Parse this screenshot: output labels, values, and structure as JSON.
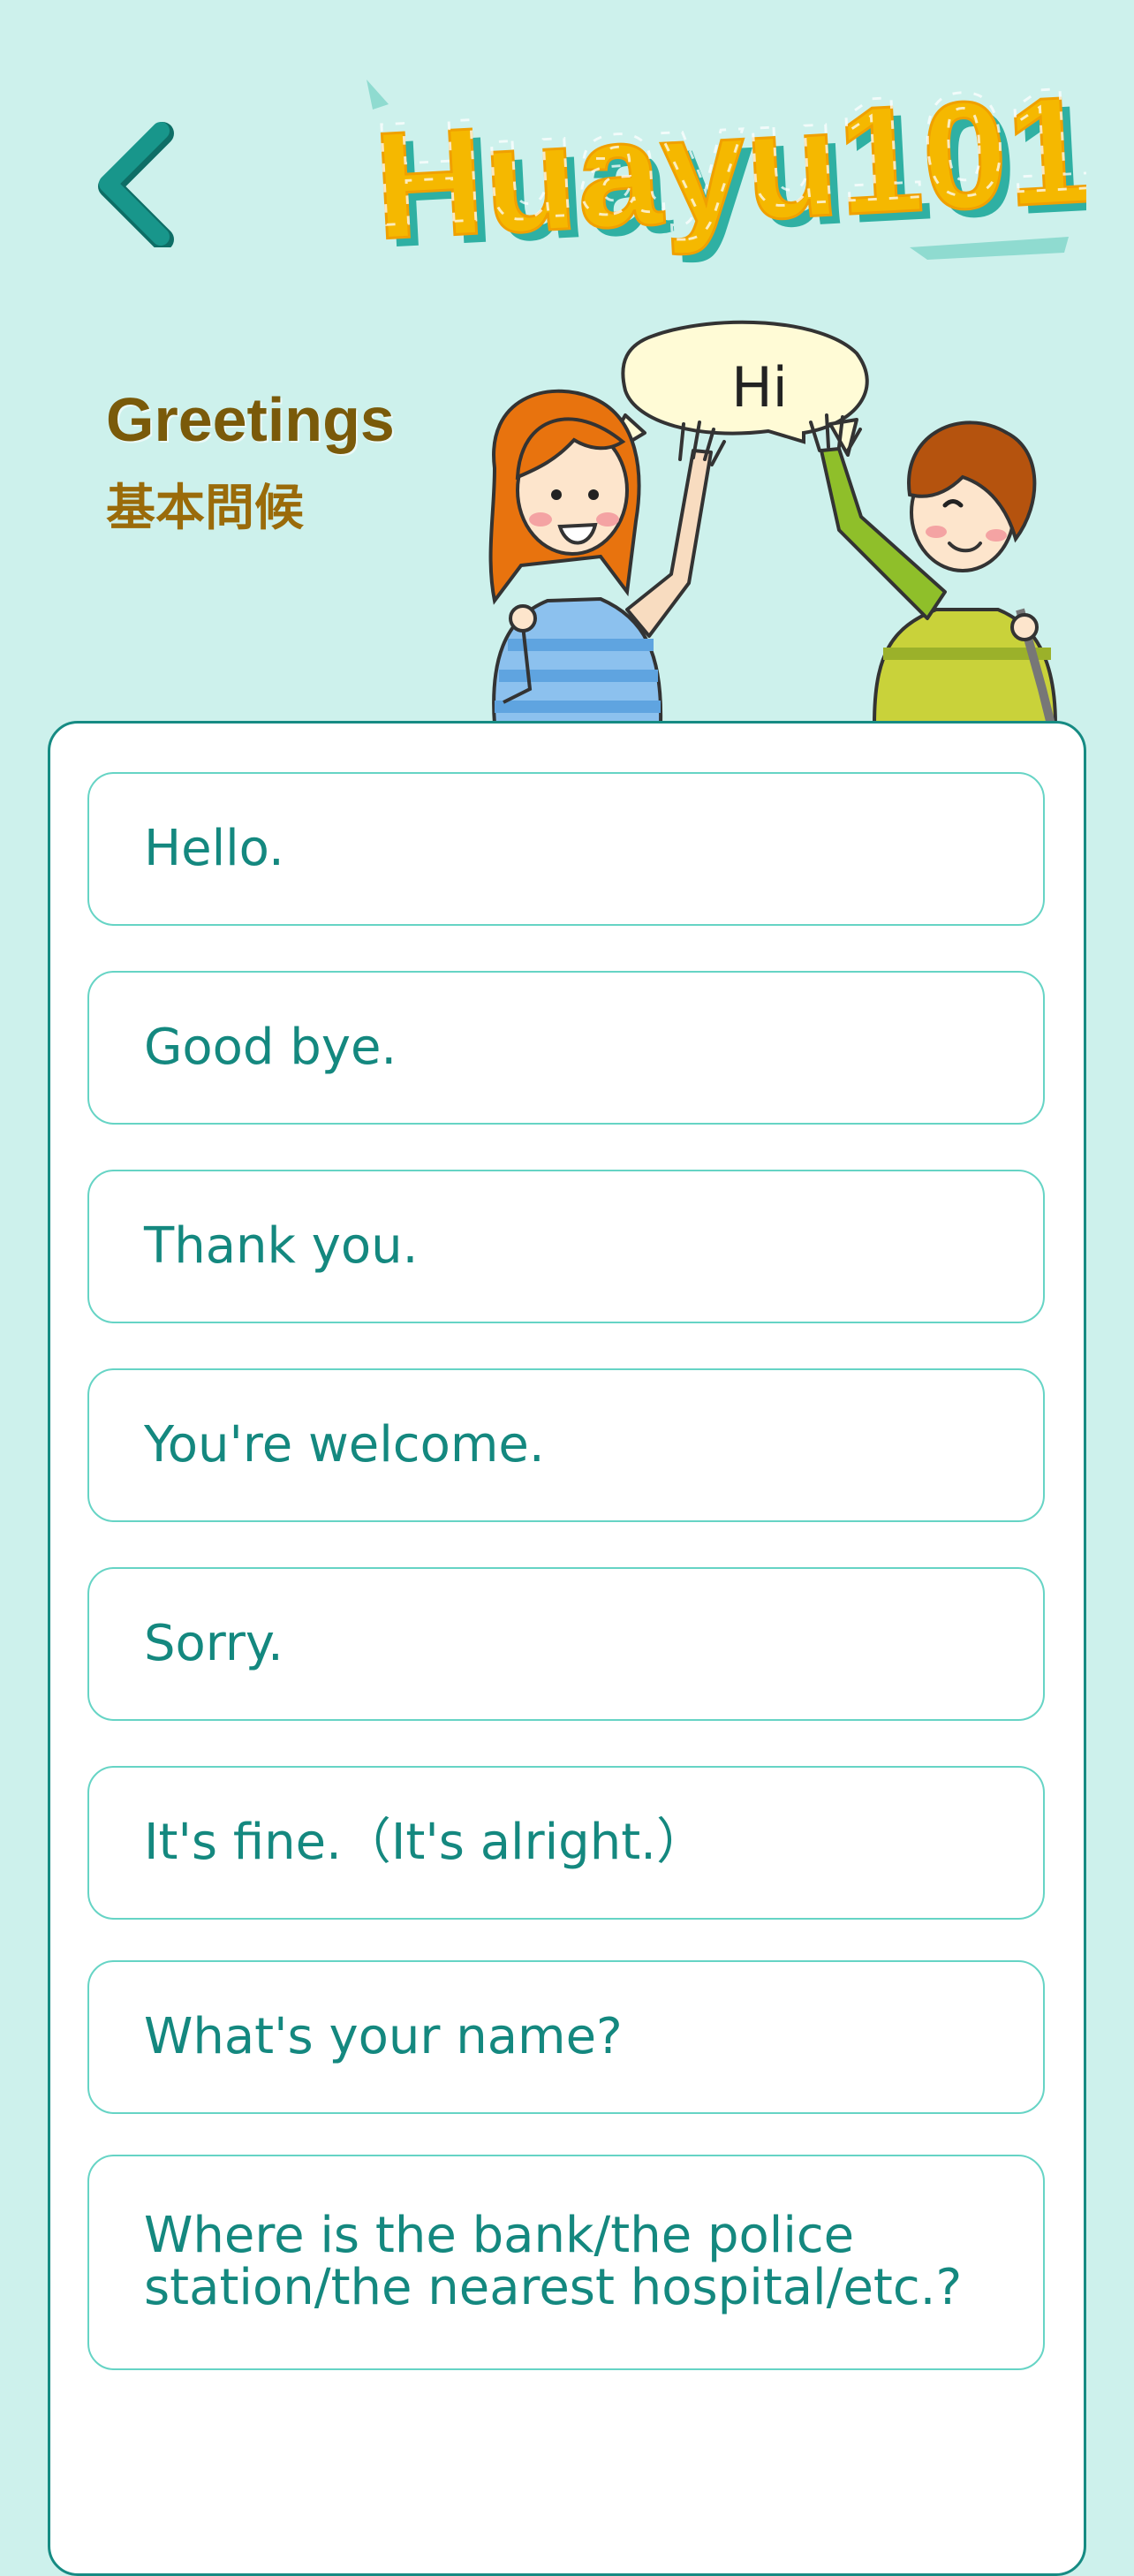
{
  "app": {
    "logo_text": "Huayu101",
    "colors": {
      "background": "#cdf1ec",
      "accent": "#14887f",
      "logo_fill": "#f5b800",
      "title_brown": "#7a5a0a"
    }
  },
  "header": {
    "back_icon": "chevron-left-icon",
    "title_en": "Greetings",
    "title_zh": "基本問候"
  },
  "illustration": {
    "speech_bubble": "Hi"
  },
  "phrases": [
    "Hello.",
    "Good bye.",
    "Thank you.",
    "You're welcome.",
    "Sorry.",
    "It's fine.（It's alright.）",
    "What's your name?",
    "Where is the bank/the police station/the nearest hospital/etc.?"
  ]
}
